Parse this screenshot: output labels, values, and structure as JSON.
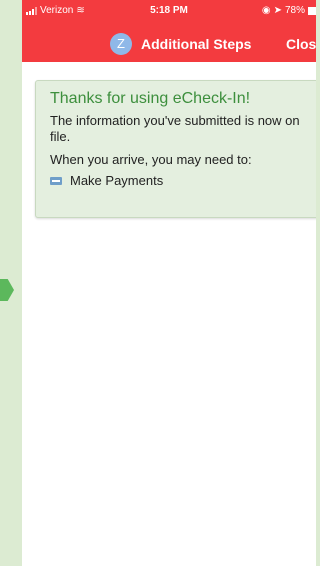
{
  "status_bar": {
    "carrier": "Verizon",
    "time": "5:18 PM",
    "battery": "78%"
  },
  "header": {
    "avatar_letter": "Z",
    "title": "Additional Steps",
    "close_label": "Close",
    "color": "#f33b3f"
  },
  "card": {
    "title": "Thanks for using eCheck-In!",
    "message": "The information you've submitted is now on file.",
    "arrive_text": "When you arrive, you may need to:",
    "steps": [
      {
        "icon": "credit-card-icon",
        "label": "Make Payments"
      }
    ],
    "title_color": "#3d8f3d",
    "background": "#e4efdf"
  }
}
